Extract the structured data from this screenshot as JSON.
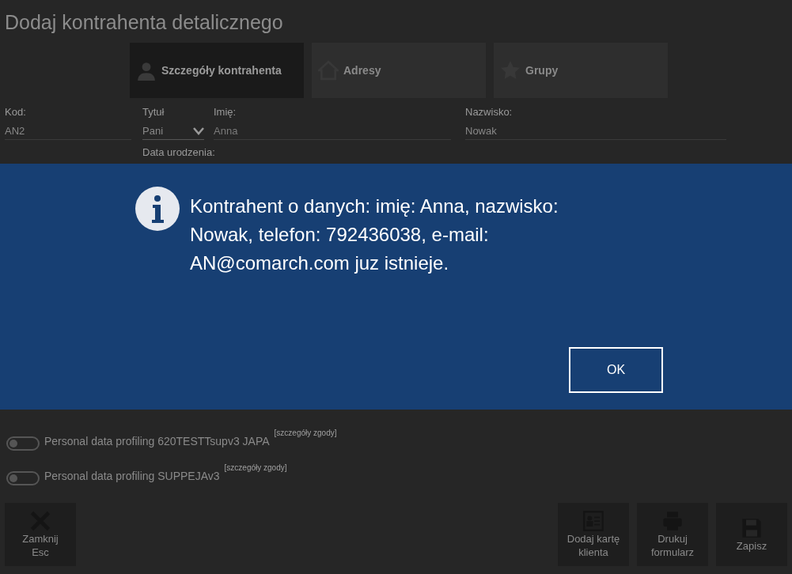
{
  "window": {
    "title": "Dodaj kontrahenta detalicznego"
  },
  "tabs": [
    {
      "label": "Szczegóły kontrahenta",
      "kind": "person",
      "selected": true
    },
    {
      "label": "Adresy",
      "kind": "home",
      "selected": false
    },
    {
      "label": "Grupy",
      "kind": "star",
      "selected": false
    }
  ],
  "form": {
    "kod": {
      "label": "Kod:",
      "value": "AN2"
    },
    "tytul": {
      "label": "Tytuł",
      "value": "Pani"
    },
    "imie": {
      "label": "Imię:",
      "value": "Anna"
    },
    "nazwisko": {
      "label": "Nazwisko:",
      "value": "Nowak"
    },
    "data_urodzenia": {
      "label": "Data urodzenia:"
    }
  },
  "consents": [
    {
      "label": "Personal data profiling 620TESTTsupv3 JAPA",
      "link": "[szczegóły zgody]",
      "on": false
    },
    {
      "label": "Personal data profiling SUPPEJAv3",
      "link": "[szczegóły zgody]",
      "on": false
    }
  ],
  "dialog": {
    "message": "Kontrahent o danych: imię: Anna, nazwisko: Nowak, telefon: 792436038, e-mail: AN@comarch.com juz istnieje.",
    "button": "OK"
  },
  "footer": {
    "left": [
      {
        "kind": "close",
        "lines": [
          "Zamknij",
          "Esc"
        ]
      }
    ],
    "right": [
      {
        "kind": "card",
        "lines": [
          "Dodaj kartę",
          "klienta"
        ]
      },
      {
        "kind": "print",
        "lines": [
          "Drukuj",
          "formularz"
        ]
      },
      {
        "kind": "save",
        "lines": [
          "Zapisz"
        ]
      }
    ]
  }
}
